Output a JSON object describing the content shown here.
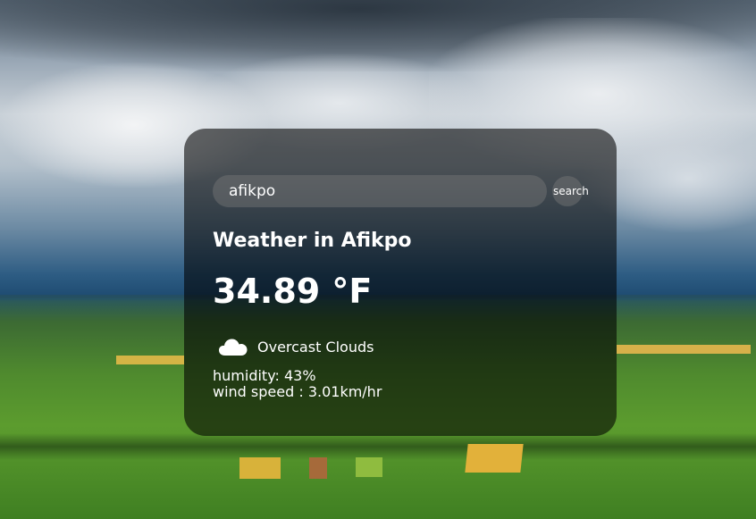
{
  "search": {
    "value": "afikpo",
    "button_label": "search"
  },
  "weather": {
    "title": "Weather in Afikpo",
    "temperature": "34.89 °F",
    "icon": "cloud-icon",
    "description": "Overcast Clouds",
    "humidity": "humidity: 43%",
    "wind": "wind speed : 3.01km/hr"
  },
  "colors": {
    "card_background": "rgba(0,0,0,0.58)",
    "input_background": "rgba(124,124,124,0.43)",
    "text": "#ffffff"
  }
}
